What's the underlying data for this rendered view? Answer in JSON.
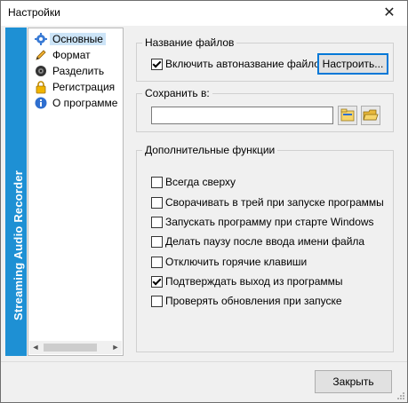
{
  "window": {
    "title": "Настройки",
    "close_symbol": "✕"
  },
  "banner": {
    "text": "Streaming Audio Recorder"
  },
  "nav": {
    "items": [
      {
        "label": "Основные",
        "icon": "gear-icon",
        "selected": true
      },
      {
        "label": "Формат",
        "icon": "pencil-icon",
        "selected": false
      },
      {
        "label": "Разделить",
        "icon": "speaker-icon",
        "selected": false
      },
      {
        "label": "Регистрация",
        "icon": "lock-icon",
        "selected": false
      },
      {
        "label": "О программе",
        "icon": "info-icon",
        "selected": false
      }
    ],
    "scroll_left": "◄",
    "scroll_right": "►"
  },
  "filename_group": {
    "title": "Название файлов",
    "auto_name_label": "Включить автоназвание файлов",
    "auto_name_checked": true,
    "configure_button": "Настроить..."
  },
  "save_group": {
    "title": "Сохранить в:",
    "path_value": ""
  },
  "extra_group": {
    "title": "Дополнительные функции",
    "options": [
      {
        "label": "Всегда сверху",
        "checked": false
      },
      {
        "label": "Сворачивать в трей при запуске программы",
        "checked": false
      },
      {
        "label": "Запускать программу при старте Windows",
        "checked": false
      },
      {
        "label": "Делать паузу после ввода имени файла",
        "checked": false
      },
      {
        "label": "Отключить горячие клавиши",
        "checked": false
      },
      {
        "label": "Подтверждать выход из программы",
        "checked": true
      },
      {
        "label": "Проверять обновления при запуске",
        "checked": false
      }
    ]
  },
  "footer": {
    "close_button": "Закрыть"
  },
  "colors": {
    "banner": "#1e90d4",
    "selection": "#cce4f7",
    "focus": "#0078d7"
  }
}
